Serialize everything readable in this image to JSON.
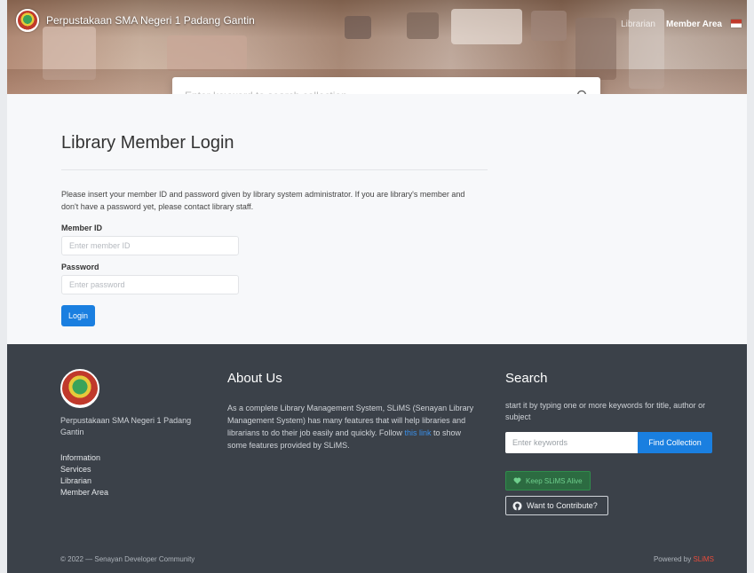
{
  "header": {
    "brand": "Perpustakaan SMA Negeri 1 Padang Gantin",
    "nav": [
      {
        "label": "Librarian"
      },
      {
        "label": "Member Area"
      }
    ]
  },
  "search": {
    "placeholder": "Enter keyword to search collection..."
  },
  "login": {
    "title": "Library Member Login",
    "intro": "Please insert your member ID and password given by library system administrator. If you are library's member and don't have a password yet, please contact library staff.",
    "member_id_label": "Member ID",
    "member_id_placeholder": "Enter member ID",
    "password_label": "Password",
    "password_placeholder": "Enter password",
    "login_button": "Login"
  },
  "footer": {
    "brand": "Perpustakaan SMA Negeri 1 Padang Gantin",
    "links": [
      "Information",
      "Services",
      "Librarian",
      "Member Area"
    ],
    "about_title": "About Us",
    "about_text_1": "As a complete Library Management System, SLiMS (Senayan Library Management System) has many features that will help libraries and librarians to do their job easily and quickly. Follow",
    "about_link": "this link",
    "about_text_2": "to show some features provided by SLiMS.",
    "search_title": "Search",
    "search_text": "start it by typing one or more keywords for title, author or subject",
    "search_placeholder": "Enter keywords",
    "search_button": "Find Collection",
    "love_button": "Keep SLiMS Alive",
    "contribute_button": "Want to Contribute?",
    "copyright": "© 2022 — Senayan Developer Community",
    "powered_by": "Powered by",
    "powered_name": "SLiMS"
  },
  "colors": {
    "accent": "#1a7fe0",
    "footer_bg": "#3b4149"
  }
}
